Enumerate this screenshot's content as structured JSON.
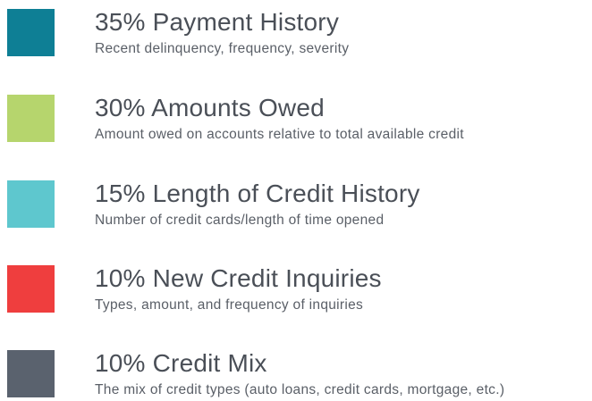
{
  "legend": {
    "items": [
      {
        "percent": "35%",
        "title": "35% Payment History",
        "description": "Recent delinquency, frequency, severity",
        "color": "#0e7f95"
      },
      {
        "percent": "30%",
        "title": "30% Amounts Owed",
        "description": "Amount owed on accounts relative to total available credit",
        "color": "#b6d56d"
      },
      {
        "percent": "15%",
        "title": "15% Length of Credit History",
        "description": "Number of credit cards/length of time opened",
        "color": "#5ec7ce"
      },
      {
        "percent": "10%",
        "title": "10% New Credit Inquiries",
        "description": "Types, amount, and frequency of inquiries",
        "color": "#ef3e3e"
      },
      {
        "percent": "10%",
        "title": "10% Credit Mix",
        "description": "The mix of credit types (auto loans, credit cards, mortgage, etc.)",
        "color": "#5a626e"
      }
    ]
  }
}
